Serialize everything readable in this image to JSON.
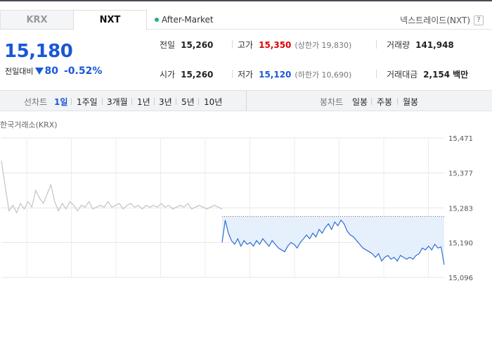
{
  "tabs": {
    "krx": "KRX",
    "nxt": "NXT"
  },
  "session": "After-Market",
  "nxt_link": "넥스트레이드(NXT)",
  "help": "?",
  "price": {
    "current": "15,180",
    "change_label": "전일대비",
    "change": "80",
    "change_pct": "-0.52%"
  },
  "stats": {
    "prev_close": {
      "label": "전일",
      "value": "15,260"
    },
    "open": {
      "label": "시가",
      "value": "15,260"
    },
    "high": {
      "label": "고가",
      "value": "15,350",
      "sub": "(상한가 19,830)"
    },
    "low": {
      "label": "저가",
      "value": "15,120",
      "sub": "(하한가 10,690)"
    },
    "volume": {
      "label": "거래량",
      "value": "141,948"
    },
    "amount": {
      "label": "거래대금",
      "value": "2,154",
      "unit": "백만"
    }
  },
  "toolbar": {
    "line_label": "선차트",
    "periods": [
      "1일",
      "1주일",
      "3개월",
      "1년",
      "3년",
      "5년",
      "10년"
    ],
    "active_period": "1일",
    "candle_label": "봉차트",
    "candles": [
      "일봉",
      "주봉",
      "월봉"
    ]
  },
  "chart_title": "한국거래소(KRX)",
  "colors": {
    "down": "#1a57d6",
    "up": "#e00000",
    "krx_line": "#c4c4c4",
    "nxt_line": "#2f6fd3",
    "fill": "#e6effc"
  },
  "chart_data": {
    "type": "line",
    "title": "한국거래소(KRX)",
    "ylim": [
      15096,
      15471
    ],
    "y_ticks": [
      "15,471",
      "15,377",
      "15,283",
      "15,190",
      "15,096"
    ],
    "y_tick_values": [
      15471,
      15377,
      15283,
      15190,
      15096
    ],
    "reference": 15260,
    "grid": true,
    "series": [
      {
        "values": [
          15410,
          15340,
          15275,
          15290,
          15270,
          15295,
          15280,
          15300,
          15285,
          15330,
          15310,
          15295,
          15320,
          15345,
          15300,
          15275,
          15295,
          15280,
          15300,
          15290,
          15275,
          15290,
          15285,
          15300,
          15280,
          15285,
          15290,
          15285,
          15300,
          15285,
          15290,
          15295,
          15280,
          15290,
          15295,
          15285,
          15290,
          15280,
          15290,
          15285,
          15290,
          15285,
          15295,
          15285,
          15290,
          15280,
          15285,
          15290,
          15285,
          15295,
          15280,
          15285,
          15290,
          15285,
          15280,
          15285,
          15290,
          15285,
          15280
        ]
      },
      {
        "values": [
          15190,
          15250,
          15215,
          15195,
          15185,
          15200,
          15180,
          15195,
          15185,
          15190,
          15180,
          15195,
          15185,
          15200,
          15190,
          15180,
          15195,
          15185,
          15175,
          15170,
          15165,
          15180,
          15190,
          15185,
          15175,
          15190,
          15200,
          15210,
          15200,
          15215,
          15205,
          15225,
          15215,
          15230,
          15240,
          15225,
          15245,
          15235,
          15250,
          15240,
          15220,
          15210,
          15205,
          15195,
          15185,
          15175,
          15170,
          15165,
          15160,
          15150,
          15160,
          15140,
          15150,
          15155,
          15145,
          15150,
          15140,
          15155,
          15150,
          15145,
          15150,
          15145,
          15155,
          15160,
          15175,
          15170,
          15180,
          15170,
          15185,
          15175,
          15178,
          15130
        ]
      }
    ]
  }
}
